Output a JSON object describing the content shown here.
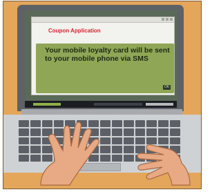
{
  "app": {
    "title": "Coupon Application",
    "message": "Your mobile loyalty card will be sent to your mobile phone via SMS",
    "ok_label": "OK"
  },
  "colors": {
    "frame": "#e3a65a",
    "screen_panel": "#8fa657",
    "title": "#d7242f",
    "laptop_body": "#5e6166",
    "skin": "#e7aa84"
  },
  "icons": [
    "laptop-illustration",
    "left-hand-illustration",
    "right-hand-illustration"
  ]
}
